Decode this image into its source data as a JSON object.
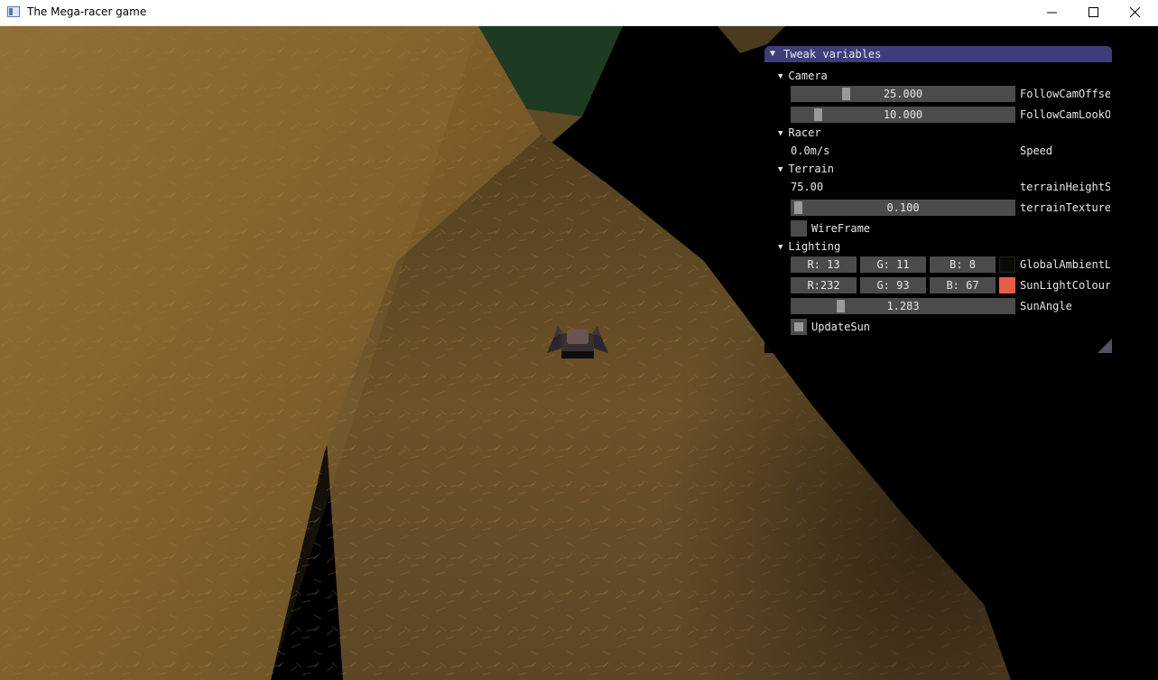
{
  "window": {
    "title": "The Mega-racer game"
  },
  "panel": {
    "title": "Tweak variables",
    "camera": {
      "header": "Camera",
      "follow_offset": {
        "value": "25.000",
        "label": "FollowCamOffse",
        "level": 0.25
      },
      "follow_look": {
        "value": "10.000",
        "label": "FollowCamLookO",
        "level": 0.1
      }
    },
    "racer": {
      "header": "Racer",
      "speed_value": "0.0m/s",
      "speed_label": "Speed"
    },
    "terrain": {
      "header": "Terrain",
      "height_value": "75.00",
      "height_label": "terrainHeightS",
      "texture": {
        "value": "0.100",
        "label": "terrainTexture",
        "level": 0.01
      },
      "wireframe_label": "WireFrame",
      "wireframe_checked": false
    },
    "lighting": {
      "header": "Lighting",
      "ambient": {
        "r": "R: 13",
        "g": "G: 11",
        "b": "B:  8",
        "label": "GlobalAmbientL",
        "color": "#0d0b08"
      },
      "sun_colour": {
        "r": "R:232",
        "g": "G: 93",
        "b": "B: 67",
        "label": "SunLightColour",
        "color": "#e85d43"
      },
      "sun_angle": {
        "value": "1.283",
        "label": "SunAngle",
        "level": 0.2
      },
      "update_sun_label": "UpdateSun",
      "update_sun_checked": true
    }
  },
  "colors": {
    "panel_title_bg": "#3e3e7b",
    "frame_bg": "#4b4b4b",
    "grass": "#8a6a30"
  }
}
